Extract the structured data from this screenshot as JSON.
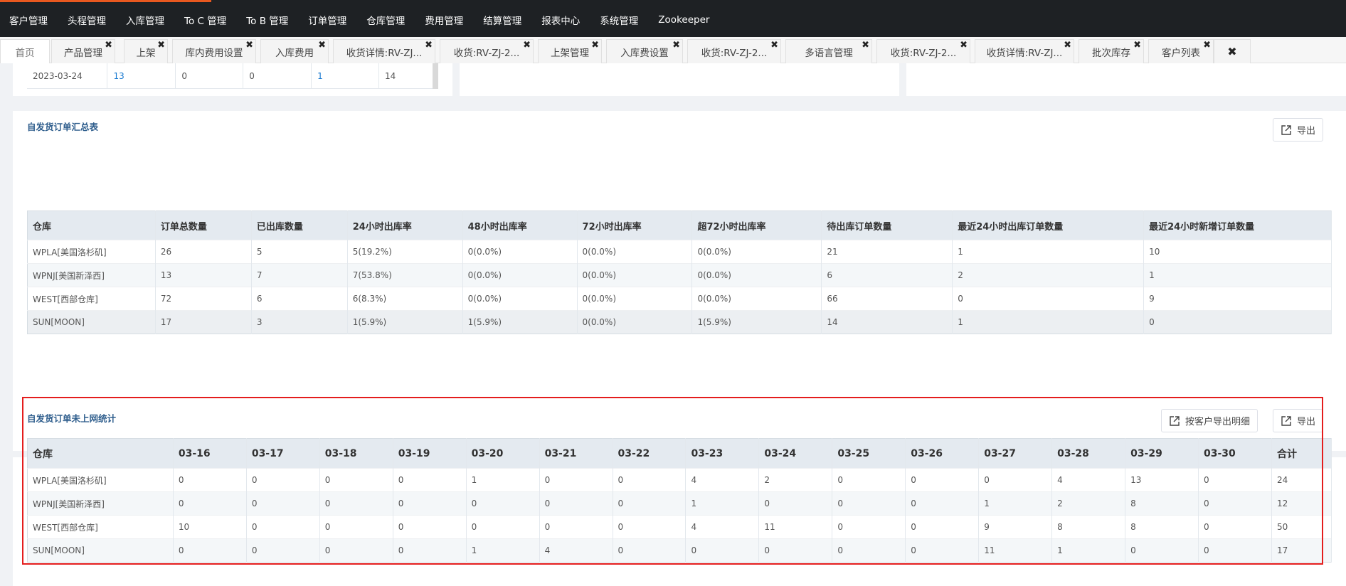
{
  "topnav": {
    "items": [
      "客户管理",
      "头程管理",
      "入库管理",
      "To C 管理",
      "To B 管理",
      "订单管理",
      "仓库管理",
      "费用管理",
      "结算管理",
      "报表中心",
      "系统管理",
      "Zookeeper"
    ]
  },
  "tabs": [
    "首页",
    "产品管理",
    "上架",
    "库内费用设置",
    "入库费用",
    "收货详情:RV-ZJ...",
    "收货:RV-ZJ-2...",
    "上架管理",
    "入库费设置",
    "收货:RV-ZJ-2...",
    "多语言管理",
    "收货:RV-ZJ-2...",
    "收货详情:RV-ZJ...",
    "批次库存",
    "客户列表"
  ],
  "tab_close_glyph": "✖",
  "closeall_glyph": "✖",
  "top_residual": {
    "cells": [
      "2023-03-24",
      "13",
      "0",
      "0",
      "1",
      "14"
    ]
  },
  "summary": {
    "title": "自发货订单汇总表",
    "export_label": "导出",
    "columns": [
      "仓库",
      "订单总数量",
      "已出库数量",
      "24小时出库率",
      "48小时出库率",
      "72小时出库率",
      "超72小时出库率",
      "待出库订单数量",
      "最近24小时出库订单数量",
      "最近24小时新增订单数量"
    ],
    "rows": [
      [
        "WPLA[美国洛杉矶]",
        "26",
        "5",
        "5(19.2%)",
        "0(0.0%)",
        "0(0.0%)",
        "0(0.0%)",
        "21",
        "1",
        "10"
      ],
      [
        "WPNJ[美国新泽西]",
        "13",
        "7",
        "7(53.8%)",
        "0(0.0%)",
        "0(0.0%)",
        "0(0.0%)",
        "6",
        "2",
        "1"
      ],
      [
        "WEST[西部仓库]",
        "72",
        "6",
        "6(8.3%)",
        "0(0.0%)",
        "0(0.0%)",
        "0(0.0%)",
        "66",
        "0",
        "9"
      ],
      [
        "SUN[MOON]",
        "17",
        "3",
        "1(5.9%)",
        "1(5.9%)",
        "0(0.0%)",
        "1(5.9%)",
        "14",
        "1",
        "0"
      ]
    ]
  },
  "unshipped": {
    "title": "自发货订单未上网统计",
    "export_by_customer_label": "按客户导出明细",
    "export_label": "导出",
    "columns": [
      "仓库",
      "03-16",
      "03-17",
      "03-18",
      "03-19",
      "03-20",
      "03-21",
      "03-22",
      "03-23",
      "03-24",
      "03-25",
      "03-26",
      "03-27",
      "03-28",
      "03-29",
      "03-30",
      "合计"
    ],
    "rows": [
      [
        "WPLA[美国洛杉矶]",
        "0",
        "0",
        "0",
        "0",
        "1",
        "0",
        "0",
        "4",
        "2",
        "0",
        "0",
        "0",
        "4",
        "13",
        "0",
        "24"
      ],
      [
        "WPNJ[美国新泽西]",
        "0",
        "0",
        "0",
        "0",
        "0",
        "0",
        "0",
        "1",
        "0",
        "0",
        "0",
        "1",
        "2",
        "8",
        "0",
        "12"
      ],
      [
        "WEST[西部仓库]",
        "10",
        "0",
        "0",
        "0",
        "0",
        "0",
        "0",
        "4",
        "11",
        "0",
        "0",
        "9",
        "8",
        "8",
        "0",
        "50"
      ],
      [
        "SUN[MOON]",
        "0",
        "0",
        "0",
        "0",
        "1",
        "4",
        "0",
        "0",
        "0",
        "0",
        "0",
        "11",
        "1",
        "0",
        "0",
        "17"
      ]
    ]
  },
  "colors": {
    "nav_bg": "#1e2124",
    "nav_accent": "#e8581f",
    "link": "#1b7bd1",
    "highlight_border": "#e41d1d",
    "header_bg": "#e4eaf0"
  }
}
